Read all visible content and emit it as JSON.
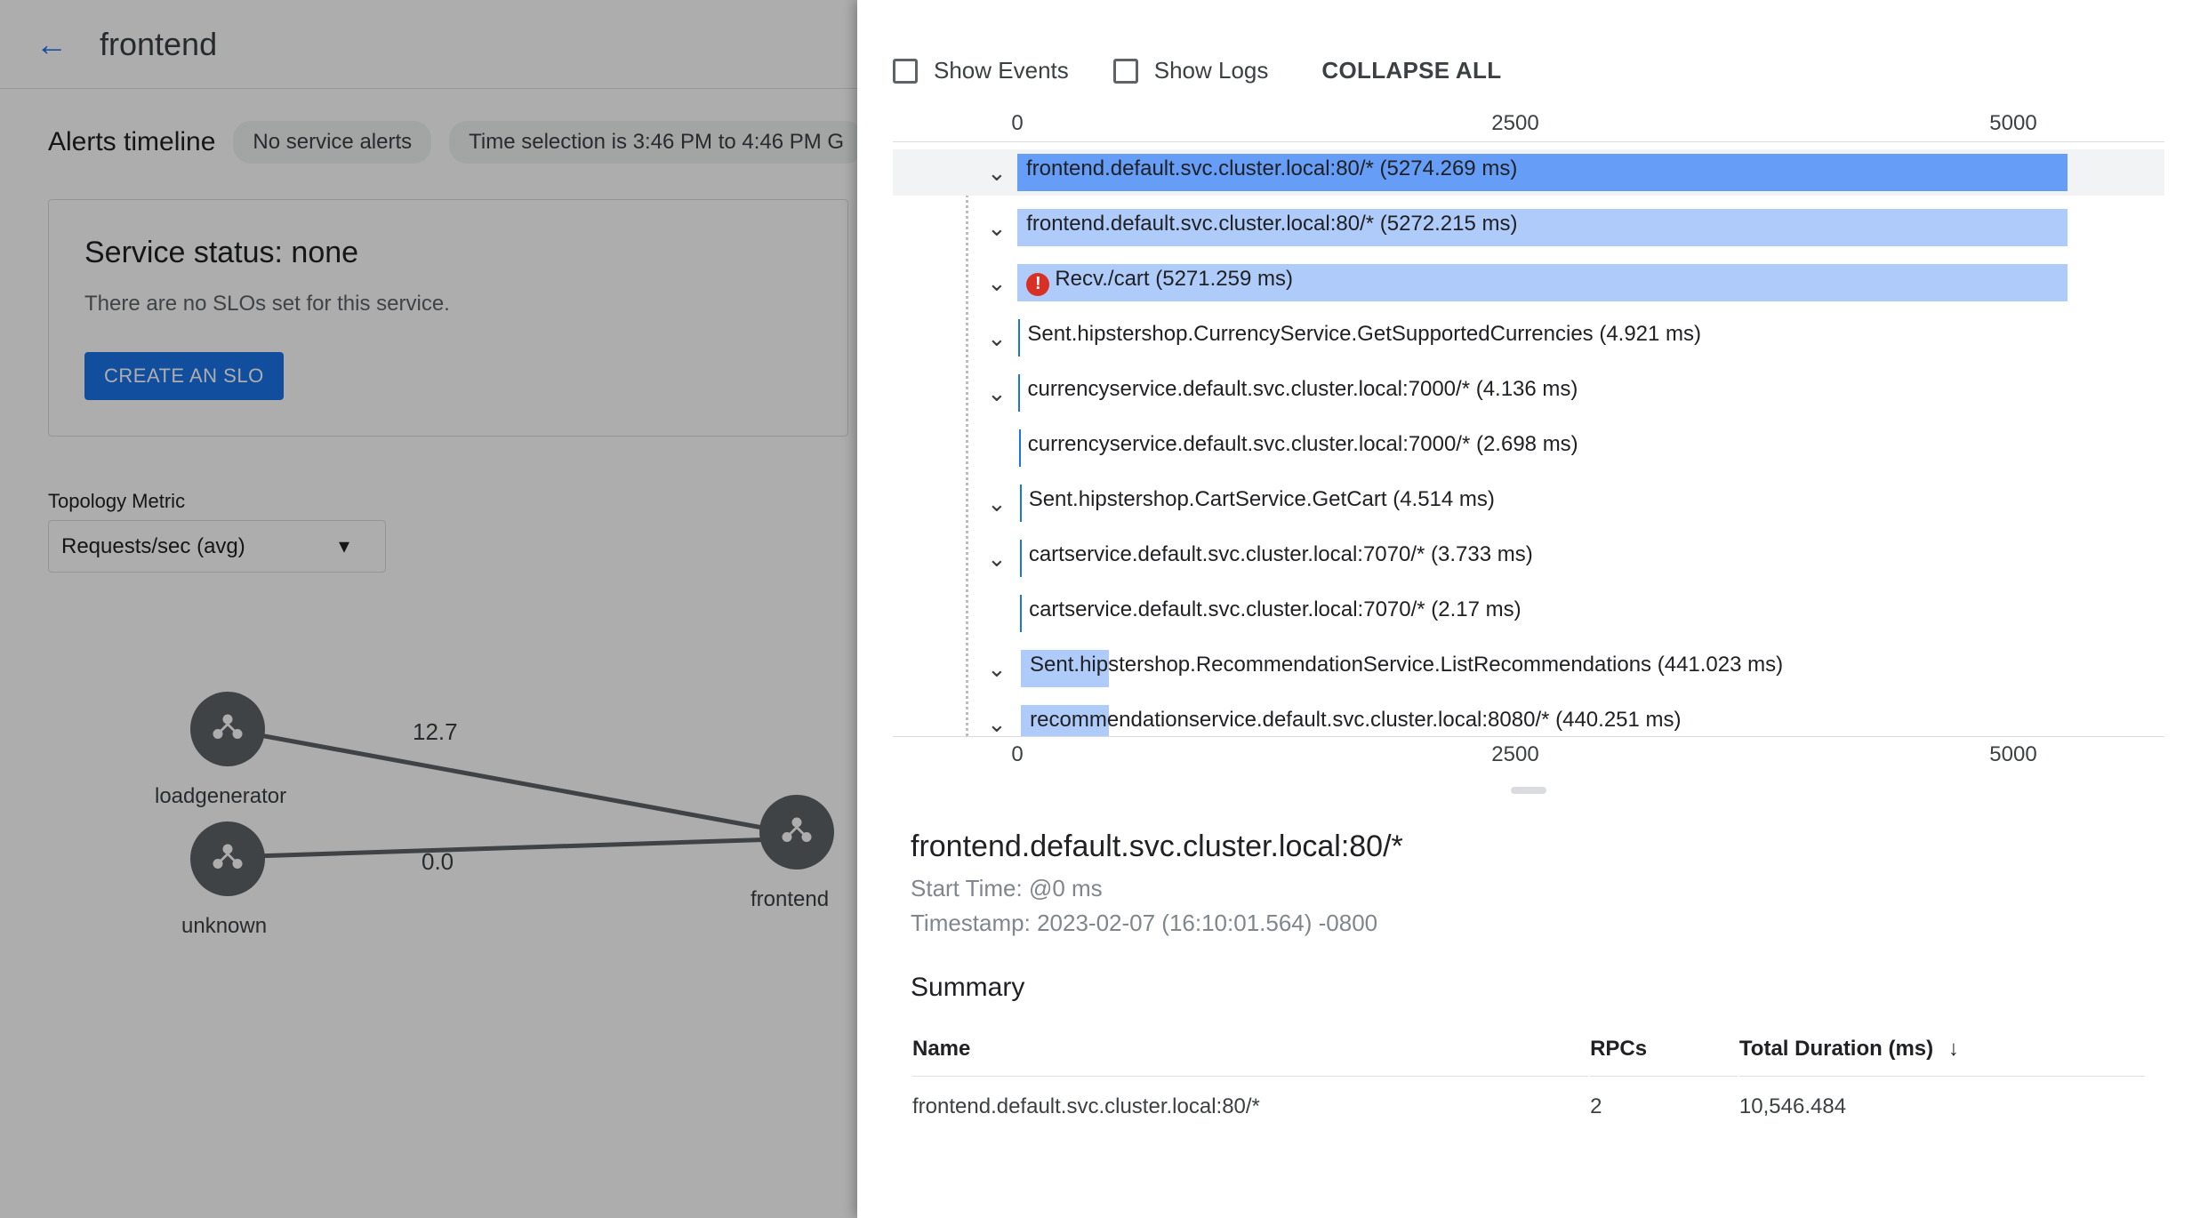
{
  "header": {
    "title": "frontend"
  },
  "alerts": {
    "label": "Alerts timeline",
    "chip1": "No service alerts",
    "chip2": "Time selection is 3:46 PM to 4:46 PM G"
  },
  "status": {
    "title": "Service status: none",
    "text": "There are no SLOs set for this service.",
    "button": "CREATE AN SLO"
  },
  "topology": {
    "label": "Topology Metric",
    "select": "Requests/sec (avg)",
    "nodes": {
      "loadgenerator": "loadgenerator",
      "unknown": "unknown",
      "frontend": "frontend"
    },
    "edges": {
      "top": "12.7",
      "bottom": "0.0"
    }
  },
  "panel": {
    "showEvents": "Show Events",
    "showLogs": "Show Logs",
    "collapse": "COLLAPSE ALL",
    "axis": {
      "t0": "0",
      "t1": "2500",
      "t2": "5000"
    },
    "maxMs": 5274.269,
    "rows": [
      {
        "label": "frontend.default.svc.cluster.local:80/* (5274.269 ms)",
        "chevron": true,
        "err": false,
        "start": 0,
        "dur": 5274.269,
        "color": "#669df6",
        "highlight": true
      },
      {
        "label": "frontend.default.svc.cluster.local:80/* (5272.215 ms)",
        "chevron": true,
        "err": false,
        "start": 0.9,
        "dur": 5272.215,
        "color": "#aecbfa"
      },
      {
        "label": "Recv./cart (5271.259 ms)",
        "chevron": true,
        "err": true,
        "start": 1.5,
        "dur": 5271.259,
        "color": "#aecbfa"
      },
      {
        "label": "Sent.hipstershop.CurrencyService.GetSupportedCurrencies (4.921 ms)",
        "chevron": true,
        "err": false,
        "start": 6.0,
        "dur": 4.921,
        "color": "#1a73e8"
      },
      {
        "label": "currencyservice.default.svc.cluster.local:7000/* (4.136 ms)",
        "chevron": true,
        "err": false,
        "start": 6.6,
        "dur": 4.136,
        "color": "#1a73e8"
      },
      {
        "label": "currencyservice.default.svc.cluster.local:7000/* (2.698 ms)",
        "chevron": false,
        "err": false,
        "start": 7.8,
        "dur": 2.698,
        "color": "#1a73e8"
      },
      {
        "label": "Sent.hipstershop.CartService.GetCart (4.514 ms)",
        "chevron": true,
        "err": false,
        "start": 12.0,
        "dur": 4.514,
        "color": "#1a73e8"
      },
      {
        "label": "cartservice.default.svc.cluster.local:7070/* (3.733 ms)",
        "chevron": true,
        "err": false,
        "start": 12.6,
        "dur": 3.733,
        "color": "#1a73e8"
      },
      {
        "label": "cartservice.default.svc.cluster.local:7070/* (2.17 ms)",
        "chevron": false,
        "err": false,
        "start": 13.8,
        "dur": 2.17,
        "color": "#1a73e8"
      },
      {
        "label": "Sent.hipstershop.RecommendationService.ListRecommendations (441.023 ms)",
        "chevron": true,
        "err": false,
        "start": 18.0,
        "dur": 441.023,
        "color": "#aecbfa"
      },
      {
        "label": "recommendationservice.default.svc.cluster.local:8080/* (440.251 ms)",
        "chevron": true,
        "err": false,
        "start": 18.6,
        "dur": 440.251,
        "color": "#aecbfa"
      }
    ]
  },
  "details": {
    "title": "frontend.default.svc.cluster.local:80/*",
    "startTimeLabel": "Start Time:",
    "startTime": "@0 ms",
    "timestampLabel": "Timestamp:",
    "timestamp": "2023-02-07 (16:10:01.564) -0800",
    "summaryLabel": "Summary",
    "columns": {
      "name": "Name",
      "rpcs": "RPCs",
      "dur": "Total Duration (ms)"
    },
    "rows": [
      {
        "name": "frontend.default.svc.cluster.local:80/*",
        "rpcs": "2",
        "dur": "10,546.484"
      }
    ]
  }
}
